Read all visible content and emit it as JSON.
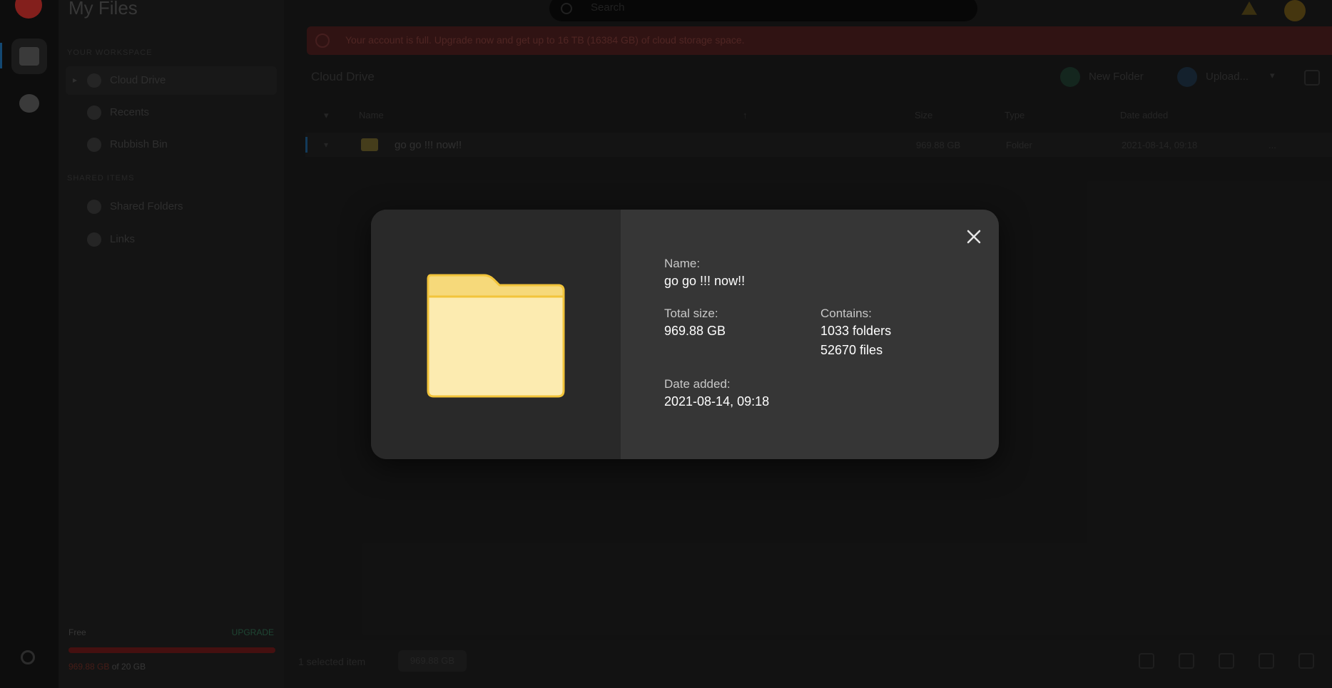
{
  "sidebar": {
    "title": "My Files",
    "section_personal": "Your workspace",
    "section_shared": "Shared items",
    "items": [
      {
        "label": "Cloud Drive"
      },
      {
        "label": "Recents"
      },
      {
        "label": "Rubbish Bin"
      },
      {
        "label": "Shared Folders"
      },
      {
        "label": "Links"
      }
    ],
    "plan": "Free",
    "upgrade": "UPGRADE",
    "usage_used": "969.88 GB",
    "usage_total": "of 20 GB"
  },
  "topbar": {
    "search_placeholder": "Search"
  },
  "banner": {
    "text": "Your account is full. Upgrade now and get up to 16 TB (16384 GB) of cloud storage space."
  },
  "content": {
    "breadcrumb": "Cloud Drive",
    "new_folder": "New Folder",
    "upload": "Upload...",
    "columns": {
      "name": "Name",
      "size": "Size",
      "type": "Type",
      "date": "Date added"
    },
    "rows": [
      {
        "name": "go go !!! now!!",
        "size": "969.88 GB",
        "type": "Folder",
        "date": "2021-08-14, 09:18",
        "more": "..."
      }
    ]
  },
  "footer": {
    "selected": "1 selected item",
    "size": "969.88 GB"
  },
  "modal": {
    "name_label": "Name:",
    "name_value": "go go !!! now!!",
    "size_label": "Total size:",
    "size_value": "969.88 GB",
    "contains_label": "Contains:",
    "contains_folders": "1033 folders",
    "contains_files": "52670 files",
    "date_label": "Date added:",
    "date_value": "2021-08-14, 09:18"
  },
  "colors": {
    "folder_fill": "#fcebb0",
    "folder_tab": "#f6d97a",
    "folder_stroke": "#f2c43a",
    "modal_bg": "#363636",
    "modal_preview_bg": "#292929"
  }
}
